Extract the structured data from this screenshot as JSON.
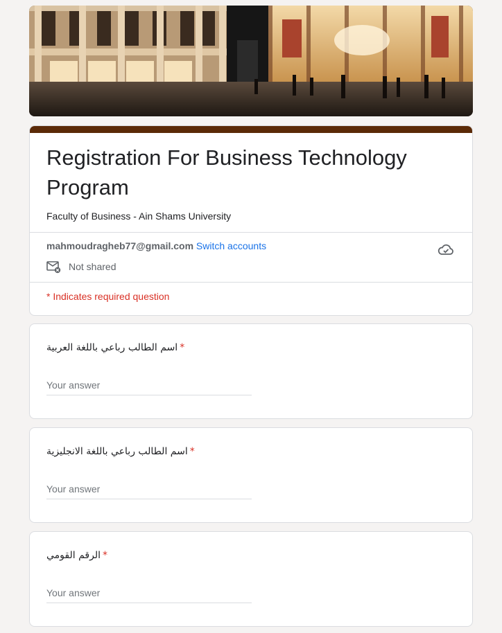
{
  "form": {
    "title": "Registration For Business Technology Program",
    "description": "Faculty of Business - Ain Shams University",
    "theme_color": "#5b2a07",
    "account": {
      "email": "mahmoudragheb77@gmail.com",
      "switch_label": "Switch accounts",
      "shared_status": "Not shared"
    },
    "required_note": "* Indicates required question",
    "questions": [
      {
        "label": "اسم الطالب رباعي باللغة العربية",
        "required_mark": "*",
        "placeholder": "Your answer"
      },
      {
        "label": "اسم الطالب رباعي باللغة الانجليزية",
        "required_mark": "*",
        "placeholder": "Your answer"
      },
      {
        "label": "الرقم القومي",
        "required_mark": "*",
        "placeholder": "Your answer"
      }
    ]
  },
  "icons": {
    "cloud": "cloud-sync-icon",
    "mail": "mail-not-shared-icon"
  }
}
